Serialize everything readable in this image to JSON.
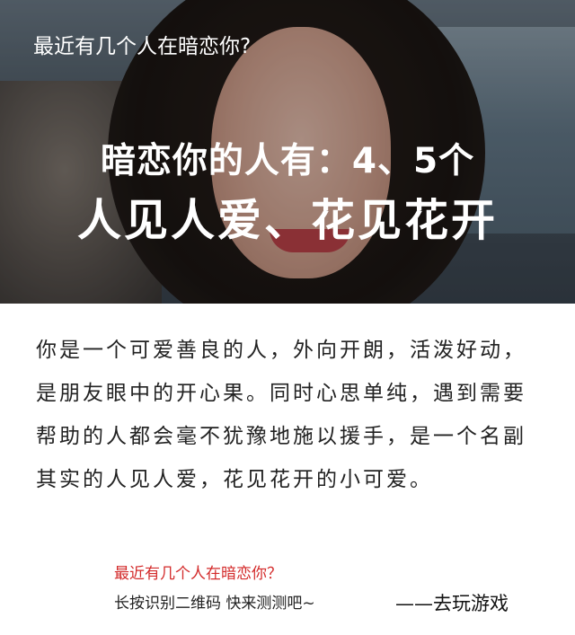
{
  "header": {
    "question": "最近有几个人在暗恋你?"
  },
  "result": {
    "line1": "暗恋你的人有：4、5个",
    "line2": "人见人爱、花见花开"
  },
  "description": "你是一个可爱善良的人，外向开朗，活泼好动，是朋友眼中的开心果。同时心思单纯，遇到需要帮助的人都会毫不犹豫地施以援手，是一个名副其实的人见人爱，花见花开的小可爱。",
  "footer": {
    "question": "最近有几个人在暗恋你？",
    "instruction": "长按识别二维码  快来测测吧~",
    "play_link": "——去玩游戏"
  },
  "colors": {
    "footer_question": "#d32a2a"
  }
}
